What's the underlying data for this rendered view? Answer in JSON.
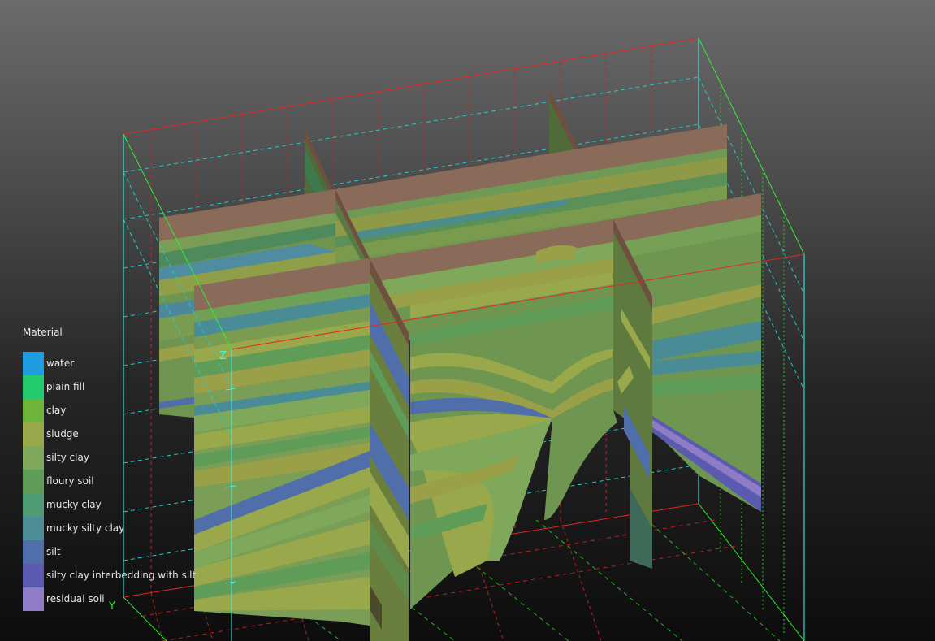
{
  "legend": {
    "title": "Material",
    "items": [
      {
        "label": "water",
        "color": "#1f9de0"
      },
      {
        "label": "plain fill",
        "color": "#22cc6e"
      },
      {
        "label": "clay",
        "color": "#6fb43a"
      },
      {
        "label": "sludge",
        "color": "#98a84a"
      },
      {
        "label": "silty clay",
        "color": "#7fa85a"
      },
      {
        "label": "floury soil",
        "color": "#5e9c58"
      },
      {
        "label": "mucky clay",
        "color": "#4f9c74"
      },
      {
        "label": "mucky silty clay",
        "color": "#4e8d95"
      },
      {
        "label": "silt",
        "color": "#4f6eaa"
      },
      {
        "label": "silty clay interbedding with silt",
        "color": "#5a5bb0"
      },
      {
        "label": "residual soil",
        "color": "#8f7cc6"
      }
    ]
  },
  "axes": {
    "z_label": "Z",
    "y_label": "Y"
  },
  "colors": {
    "topsoil": "#8a6a58",
    "panel_base": "#6e9650",
    "bounding_box_x": "#ff2a2a",
    "bounding_box_y": "#2aff2a",
    "bounding_box_z": "#33ffee"
  }
}
